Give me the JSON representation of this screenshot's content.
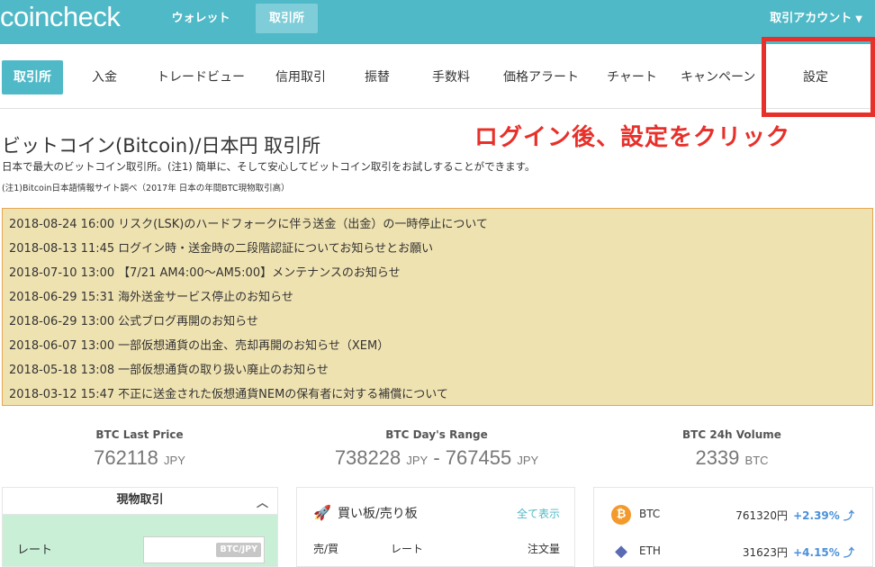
{
  "header": {
    "logo": "coincheck",
    "nav": [
      "ウォレット",
      "取引所"
    ],
    "account": "取引アカウント"
  },
  "subnav": {
    "items": [
      "取引所",
      "入金",
      "トレードビュー",
      "信用取引",
      "振替",
      "手数料",
      "価格アラート",
      "チャート",
      "キャンペーン",
      "設定"
    ]
  },
  "page": {
    "title": "ビットコイン(Bitcoin)/日本円 取引所",
    "subtitle": "日本で最大のビットコイン取引所。(注1) 簡単に、そして安心してビットコイン取引をお試しすることができます。",
    "note": "(注1)Bitcoin日本語情報サイト調べ（2017年 日本の年間BTC現物取引高）"
  },
  "annotation": "ログイン後、設定をクリック",
  "news": [
    {
      "date": "2018-08-24 16:00",
      "text": "リスク(LSK)のハードフォークに伴う送金（出金）の一時停止について"
    },
    {
      "date": "2018-08-13 11:45",
      "text": "ログイン時・送金時の二段階認証についてお知らせとお願い"
    },
    {
      "date": "2018-07-10 13:00",
      "text": "【7/21 AM4:00〜AM5:00】メンテナンスのお知らせ"
    },
    {
      "date": "2018-06-29 15:31",
      "text": "海外送金サービス停止のお知らせ"
    },
    {
      "date": "2018-06-29 13:00",
      "text": "公式ブログ再開のお知らせ"
    },
    {
      "date": "2018-06-07 13:00",
      "text": "一部仮想通貨の出金、売却再開のお知らせ（XEM）"
    },
    {
      "date": "2018-05-18 13:08",
      "text": "一部仮想通貨の取り扱い廃止のお知らせ"
    },
    {
      "date": "2018-03-12 15:47",
      "text": "不正に送金された仮想通貨NEMの保有者に対する補償について"
    }
  ],
  "stats": {
    "last_price": {
      "label": "BTC Last Price",
      "value": "762118",
      "unit": "JPY"
    },
    "range": {
      "label": "BTC Day's Range",
      "low": "738228",
      "high": "767455",
      "unit": "JPY",
      "sep": "-"
    },
    "volume": {
      "label": "BTC 24h Volume",
      "value": "2339",
      "unit": "BTC"
    }
  },
  "trade_panel": {
    "title": "現物取引",
    "rate_label": "レート",
    "pair": "BTC/JPY"
  },
  "orderbook": {
    "title": "買い板/売り板",
    "show_all": "全て表示",
    "columns": [
      "売/買",
      "レート",
      "注文量"
    ]
  },
  "markets": [
    {
      "symbol": "BTC",
      "icon": "bitcoin-icon",
      "price": "761320円",
      "change": "+2.39%"
    },
    {
      "symbol": "ETH",
      "icon": "ethereum-icon",
      "price": "31623円",
      "change": "+4.15%"
    }
  ],
  "colors": {
    "brand": "#4fb9c7",
    "annotation": "#e8302a",
    "news_bg": "#efe2b1",
    "trade_bg": "#c9efd7",
    "up": "#4a90d9"
  }
}
